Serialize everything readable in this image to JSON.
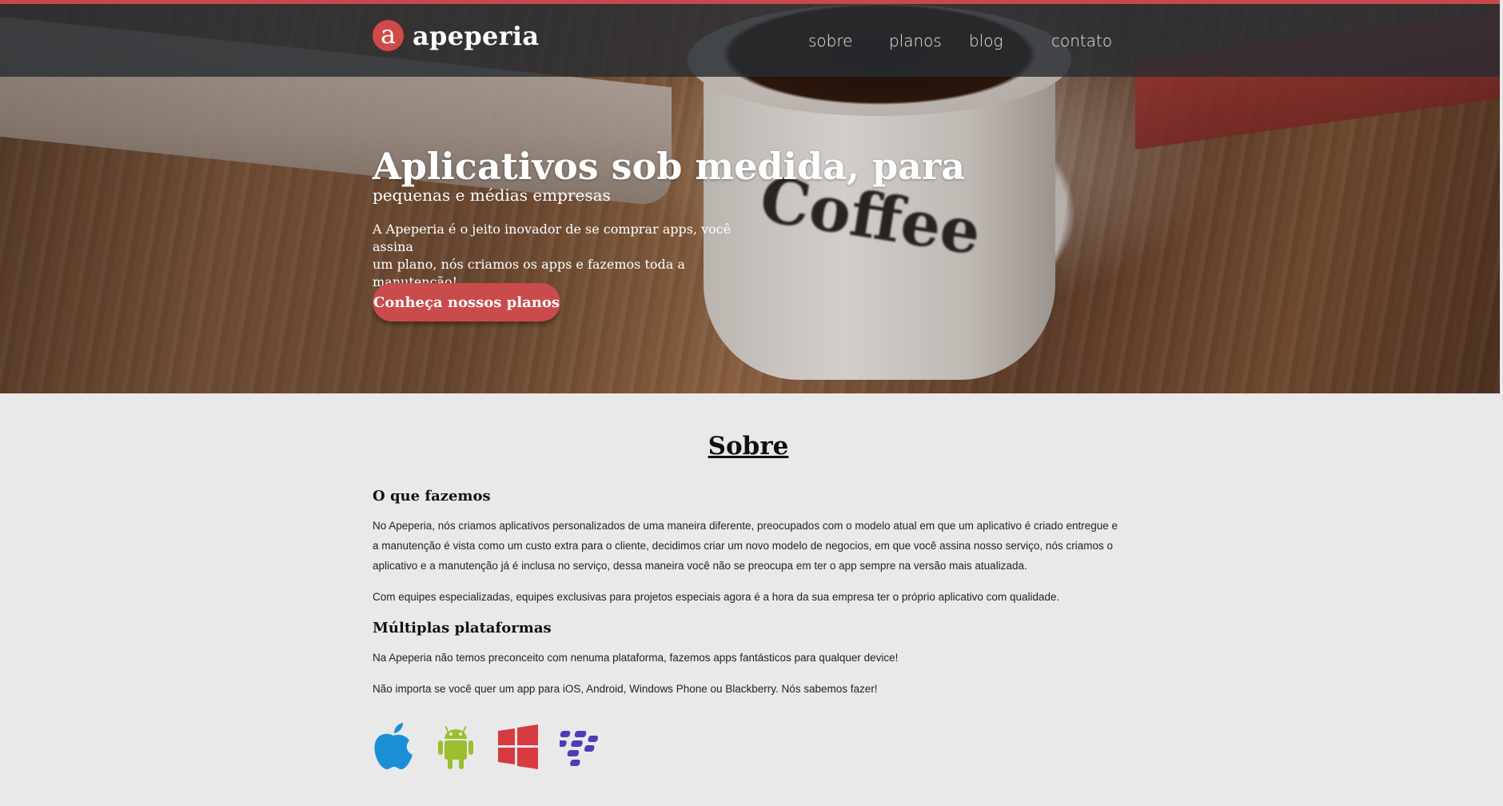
{
  "nav": {
    "brand_letter": "a",
    "brand_name": "apeperia",
    "links": [
      "sobre",
      "planos",
      "blog",
      "contato"
    ]
  },
  "hero": {
    "title": "Aplicativos sob medida, para",
    "subtitle": "pequenas e médias empresas",
    "description_line1": "A Apeperia é o jeito inovador de se comprar apps, você assina",
    "description_line2": "um plano, nós criamos os apps e fazemos toda a manutenção!",
    "cta_label": "Conheça nossos planos"
  },
  "about": {
    "title": "Sobre",
    "what_we_do_heading": "O que fazemos",
    "what_we_do_p1": "No Apeperia, nós criamos aplicativos personalizados de uma maneira diferente, preocupados com o modelo atual em que um aplicativo é criado entregue e a manutenção é vista como um custo extra para o cliente, decidimos criar um novo modelo de negocios, em que você assina nosso serviço, nós criamos o aplicativo e a manutenção já é inclusa no serviço, dessa maneira você não se preocupa em ter o app sempre na versão mais atualizada.",
    "what_we_do_p2": "Com equipes especializadas, equipes exclusivas para projetos especiais agora é a hora da sua empresa ter o próprio aplicativo com qualidade.",
    "platforms_heading": "Múltiplas plataformas",
    "platforms_p1": "Na Apeperia não temos preconceito com nenuma plataforma, fazemos apps fantásticos para qualquer device!",
    "platforms_p2": "Não importa se você quer um app para iOS, Android, Windows Phone ou Blackberry. Nós sabemos fazer!",
    "platform_icons": [
      "apple-icon",
      "android-icon",
      "windows-icon",
      "blackberry-icon"
    ]
  },
  "colors": {
    "accent": "#c9484b",
    "navbar": "#2b3035",
    "apple": "#1a8fd6",
    "android": "#9bbf2e",
    "windows": "#d83b3f",
    "blackberry": "#4a3eb8"
  }
}
